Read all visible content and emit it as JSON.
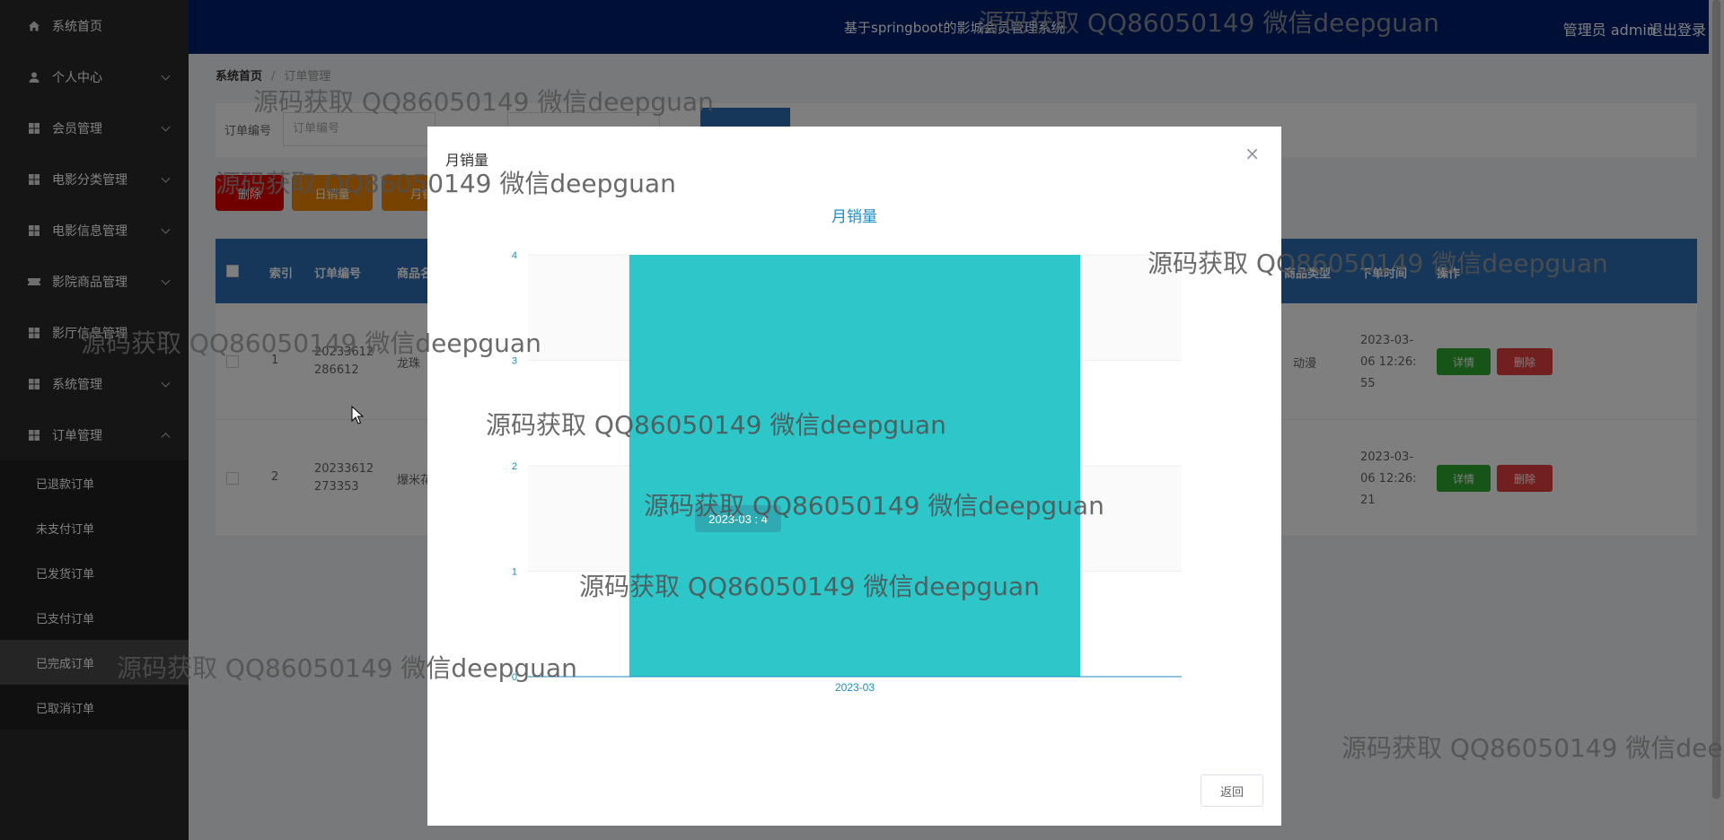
{
  "sidebar": {
    "items": [
      {
        "label": "系统首页",
        "icon": "home-icon"
      },
      {
        "label": "个人中心",
        "icon": "user-icon"
      },
      {
        "label": "会员管理",
        "icon": "grid-icon"
      },
      {
        "label": "电影分类管理",
        "icon": "grid-icon"
      },
      {
        "label": "电影信息管理",
        "icon": "grid-icon"
      },
      {
        "label": "影院商品管理",
        "icon": "ticket-icon"
      },
      {
        "label": "影厅信息管理",
        "icon": "grid-icon"
      },
      {
        "label": "系统管理",
        "icon": "grid-icon"
      },
      {
        "label": "订单管理",
        "icon": "grid-icon"
      }
    ],
    "subitems": [
      "已退款订单",
      "未支付订单",
      "已发货订单",
      "已支付订单",
      "已完成订单",
      "已取消订单"
    ],
    "active_subitem": "已完成订单"
  },
  "header": {
    "title": "基于springboot的影城会员管理系统",
    "user": "管理员 admin",
    "logout": "退出登录"
  },
  "breadcrumb": {
    "home": "系统首页",
    "current": "订单管理"
  },
  "search": {
    "label": "订单编号",
    "placeholder": "订单编号"
  },
  "toolbar": {
    "delete": "删除",
    "daily": "日销量",
    "monthly": "月销"
  },
  "table": {
    "headers": [
      "索引",
      "订单编号",
      "商品名",
      "商品类型",
      "下单时间",
      "操作"
    ],
    "rows": [
      {
        "index": "1",
        "order_no": "20233612\n286612",
        "name": "龙珠",
        "type": "动漫",
        "time": "2023-03-\n06 12:26:\n55"
      },
      {
        "index": "2",
        "order_no": "20233612\n273353",
        "name": "爆米花",
        "type": "",
        "time": "2023-03-\n06 12:26:\n21"
      }
    ],
    "detail_label": "详情",
    "delete_label": "删除"
  },
  "modal": {
    "title": "月销量",
    "back_label": "返回",
    "tooltip": "2023-03 : 4"
  },
  "chart_data": {
    "type": "bar",
    "title": "月销量",
    "categories": [
      "2023-03"
    ],
    "values": [
      4
    ],
    "ylim": [
      0,
      4
    ],
    "yticks": [
      0,
      1,
      2,
      3,
      4
    ],
    "bar_color": "#2ec7c9",
    "grid": true
  },
  "watermark": "源码获取 QQ86050149 微信deepguan"
}
